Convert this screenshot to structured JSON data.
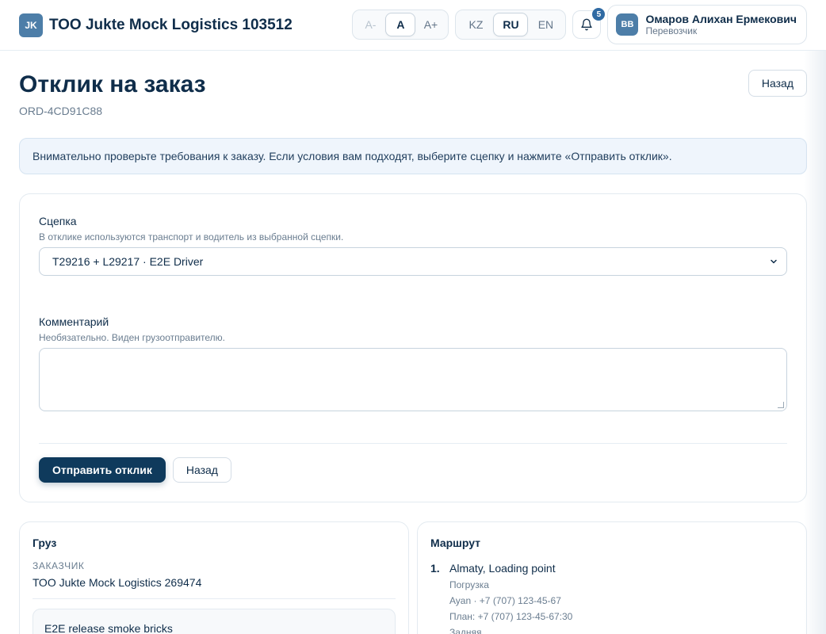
{
  "header": {
    "logo_initials": "JK",
    "company_name": "ТОО Jukte Mock Logistics 103512",
    "font_sizes": [
      "A-",
      "A",
      "A+"
    ],
    "languages": [
      "KZ",
      "RU",
      "EN"
    ],
    "notifications_count": "5",
    "user": {
      "initials": "ВВ",
      "name": "Омаров Алихан Ермекович",
      "role": "Перевозчик"
    }
  },
  "page": {
    "title": "Отклик на заказ",
    "order_id": "ORD-4CD91C88",
    "back_label": "Назад",
    "notice": "Внимательно проверьте требования к заказу. Если условия вам подходят, выберите сцепку и нажмите «Отправить отклик»."
  },
  "form": {
    "hitch_label": "Сцепка",
    "hitch_hint": "В отклике используются транспорт и водитель из выбранной сцепки.",
    "hitch_value": "T29216 + L29217 · E2E Driver",
    "comment_label": "Комментарий",
    "comment_hint": "Необязательно. Виден грузоотправителю.",
    "comment_value": "",
    "submit_label": "Отправить отклик",
    "back_label": "Назад"
  },
  "cargo": {
    "title": "Груз",
    "customer_label": "ЗАКАЗЧИК",
    "customer_value": "ТОО Jukte Mock Logistics 269474",
    "description": "E2E release smoke bricks"
  },
  "route": {
    "title": "Маршрут",
    "points": [
      {
        "num": "1.",
        "name": "Almaty, Loading point",
        "type": "Погрузка",
        "contact": "Ayan · +7 (707) 123-45-67",
        "plan": "План: +7 (707) 123-45-67:30",
        "method": "Задняя"
      }
    ]
  },
  "colors": {
    "primary": "#0f3a5c",
    "accent": "#4d7ea8",
    "notice_bg": "#eff5fc"
  }
}
